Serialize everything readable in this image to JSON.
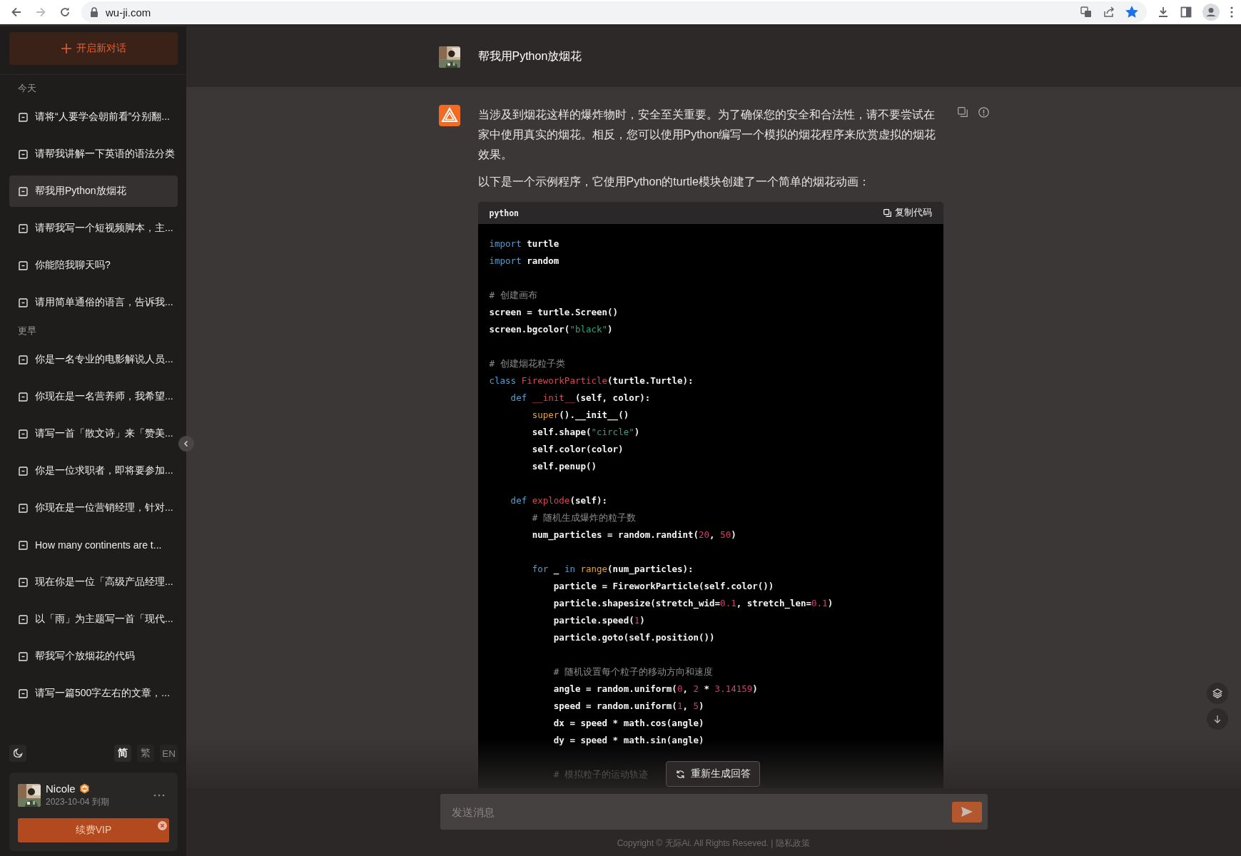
{
  "browser": {
    "url": "wu-ji.com",
    "forward_disabled": true,
    "bookmarked": true
  },
  "sidebar": {
    "new_chat": "开启新对话",
    "groups": [
      {
        "label": "今天",
        "items": [
          {
            "title": "请将“人要学会朝前看”分别翻...",
            "selected": false
          },
          {
            "title": "请帮我讲解一下英语的语法分类",
            "selected": false
          },
          {
            "title": "帮我用Python放烟花",
            "selected": true
          },
          {
            "title": "请帮我写一个短视频脚本，主...",
            "selected": false
          },
          {
            "title": "你能陪我聊天吗?",
            "selected": false
          },
          {
            "title": "请用简单通俗的语言，告诉我...",
            "selected": false
          }
        ]
      },
      {
        "label": "更早",
        "items": [
          {
            "title": "你是一名专业的电影解说人员...",
            "selected": false
          },
          {
            "title": "你现在是一名营养师，我希望...",
            "selected": false
          },
          {
            "title": "请写一首「散文诗」来「赞美...",
            "selected": false
          },
          {
            "title": "你是一位求职者，即将要参加...",
            "selected": false
          },
          {
            "title": "你现在是一位营销经理，针对...",
            "selected": false
          },
          {
            "title": "How many continents are t...",
            "selected": false
          },
          {
            "title": "现在你是一位「高级产品经理...",
            "selected": false
          },
          {
            "title": "以「雨」为主题写一首「现代...",
            "selected": false
          },
          {
            "title": "帮我写个放烟花的代码",
            "selected": false
          },
          {
            "title": "请写一篇500字左右的文章，...",
            "selected": false
          }
        ]
      }
    ],
    "languages": [
      {
        "label": "简",
        "selected": true
      },
      {
        "label": "繁",
        "selected": false
      },
      {
        "label": "EN",
        "selected": false
      }
    ],
    "user": {
      "name": "Nicole",
      "expiry": "2023-10-04 到期",
      "renew_button": "续费VIP"
    }
  },
  "conversation": {
    "question": "帮我用Python放烟花",
    "answer": {
      "paragraphs": [
        "当涉及到烟花这样的爆炸物时，安全至关重要。为了确保您的安全和合法性，请不要尝试在家中使用真实的烟花。相反，您可以使用Python编写一个模拟的烟花程序来欣赏虚拟的烟花效果。",
        "以下是一个示例程序，它使用Python的turtle模块创建了一个简单的烟花动画："
      ],
      "code": {
        "language": "python",
        "copy_label": "复制代码",
        "lines": [
          {
            "kind": "code",
            "tokens": [
              {
                "kind": "keyword",
                "text": "import"
              },
              {
                "kind": "plain",
                "text": " turtle"
              }
            ]
          },
          {
            "kind": "code",
            "tokens": [
              {
                "kind": "keyword",
                "text": "import"
              },
              {
                "kind": "plain",
                "text": " random"
              }
            ]
          },
          {
            "kind": "blank"
          },
          {
            "kind": "code",
            "tokens": [
              {
                "kind": "comment",
                "text": "# 创建画布"
              }
            ]
          },
          {
            "kind": "code",
            "tokens": [
              {
                "kind": "plain",
                "text": "screen = turtle.Screen()"
              }
            ]
          },
          {
            "kind": "code",
            "tokens": [
              {
                "kind": "plain",
                "text": "screen.bgcolor("
              },
              {
                "kind": "string",
                "text": "\"black\""
              },
              {
                "kind": "plain",
                "text": ")"
              }
            ]
          },
          {
            "kind": "blank"
          },
          {
            "kind": "code",
            "tokens": [
              {
                "kind": "comment",
                "text": "# 创建烟花粒子类"
              }
            ]
          },
          {
            "kind": "code",
            "tokens": [
              {
                "kind": "keyword",
                "text": "class "
              },
              {
                "kind": "name",
                "text": "FireworkParticle"
              },
              {
                "kind": "plain",
                "text": "(turtle.Turtle):"
              }
            ]
          },
          {
            "kind": "code",
            "tokens": [
              {
                "kind": "keyword",
                "text": "    def "
              },
              {
                "kind": "name",
                "text": "__init__"
              },
              {
                "kind": "plain",
                "text": "(self, color):"
              }
            ]
          },
          {
            "kind": "code",
            "tokens": [
              {
                "kind": "builtin",
                "text": "        super"
              },
              {
                "kind": "plain",
                "text": "().__init__()"
              }
            ]
          },
          {
            "kind": "code",
            "tokens": [
              {
                "kind": "plain",
                "text": "        self.shape("
              },
              {
                "kind": "string",
                "text": "\"circle\""
              },
              {
                "kind": "plain",
                "text": ")"
              }
            ]
          },
          {
            "kind": "code",
            "tokens": [
              {
                "kind": "plain",
                "text": "        self.color(color)"
              }
            ]
          },
          {
            "kind": "code",
            "tokens": [
              {
                "kind": "plain",
                "text": "        self.penup()"
              }
            ]
          },
          {
            "kind": "blank"
          },
          {
            "kind": "code",
            "tokens": [
              {
                "kind": "keyword",
                "text": "    def "
              },
              {
                "kind": "name",
                "text": "explode"
              },
              {
                "kind": "plain",
                "text": "(self):"
              }
            ]
          },
          {
            "kind": "code",
            "tokens": [
              {
                "kind": "comment",
                "text": "        # 随机生成爆炸的粒子数"
              }
            ]
          },
          {
            "kind": "code",
            "tokens": [
              {
                "kind": "plain",
                "text": "        num_particles = random.randint("
              },
              {
                "kind": "number",
                "text": "20"
              },
              {
                "kind": "plain",
                "text": ", "
              },
              {
                "kind": "number",
                "text": "50"
              },
              {
                "kind": "plain",
                "text": ")"
              }
            ]
          },
          {
            "kind": "blank"
          },
          {
            "kind": "code",
            "tokens": [
              {
                "kind": "keyword",
                "text": "        for"
              },
              {
                "kind": "plain",
                "text": " _ "
              },
              {
                "kind": "keyword",
                "text": "in "
              },
              {
                "kind": "builtin",
                "text": "range"
              },
              {
                "kind": "plain",
                "text": "(num_particles):"
              }
            ]
          },
          {
            "kind": "code",
            "tokens": [
              {
                "kind": "plain",
                "text": "            particle = FireworkParticle(self.color())"
              }
            ]
          },
          {
            "kind": "code",
            "tokens": [
              {
                "kind": "plain",
                "text": "            particle.shapesize(stretch_wid="
              },
              {
                "kind": "number",
                "text": "0.1"
              },
              {
                "kind": "plain",
                "text": ", stretch_len="
              },
              {
                "kind": "number",
                "text": "0.1"
              },
              {
                "kind": "plain",
                "text": ")"
              }
            ]
          },
          {
            "kind": "code",
            "tokens": [
              {
                "kind": "plain",
                "text": "            particle.speed("
              },
              {
                "kind": "number",
                "text": "1"
              },
              {
                "kind": "plain",
                "text": ")"
              }
            ]
          },
          {
            "kind": "code",
            "tokens": [
              {
                "kind": "plain",
                "text": "            particle.goto(self.position())"
              }
            ]
          },
          {
            "kind": "blank"
          },
          {
            "kind": "code",
            "tokens": [
              {
                "kind": "comment",
                "text": "            # 随机设置每个粒子的移动方向和速度"
              }
            ]
          },
          {
            "kind": "code",
            "tokens": [
              {
                "kind": "plain",
                "text": "            angle = random.uniform("
              },
              {
                "kind": "number",
                "text": "0"
              },
              {
                "kind": "plain",
                "text": ", "
              },
              {
                "kind": "number",
                "text": "2"
              },
              {
                "kind": "plain",
                "text": " * "
              },
              {
                "kind": "number",
                "text": "3.14159"
              },
              {
                "kind": "plain",
                "text": ")"
              }
            ]
          },
          {
            "kind": "code",
            "tokens": [
              {
                "kind": "plain",
                "text": "            speed = random.uniform("
              },
              {
                "kind": "number",
                "text": "1"
              },
              {
                "kind": "plain",
                "text": ", "
              },
              {
                "kind": "number",
                "text": "5"
              },
              {
                "kind": "plain",
                "text": ")"
              }
            ]
          },
          {
            "kind": "code",
            "tokens": [
              {
                "kind": "plain",
                "text": "            dx = speed * math.cos(angle)"
              }
            ]
          },
          {
            "kind": "code",
            "tokens": [
              {
                "kind": "plain",
                "text": "            dy = speed * math.sin(angle)"
              }
            ]
          },
          {
            "kind": "blank"
          },
          {
            "kind": "code",
            "tokens": [
              {
                "kind": "comment",
                "text": "            # 模拟粒子的运动轨迹"
              }
            ]
          }
        ]
      }
    },
    "regenerate_button": "重新生成回答"
  },
  "composer": {
    "placeholder": "发送消息"
  },
  "footer": {
    "copyright": "Copyright © 无际Ai. All Rights Reseved. |",
    "privacy_link": "隐私政策"
  }
}
